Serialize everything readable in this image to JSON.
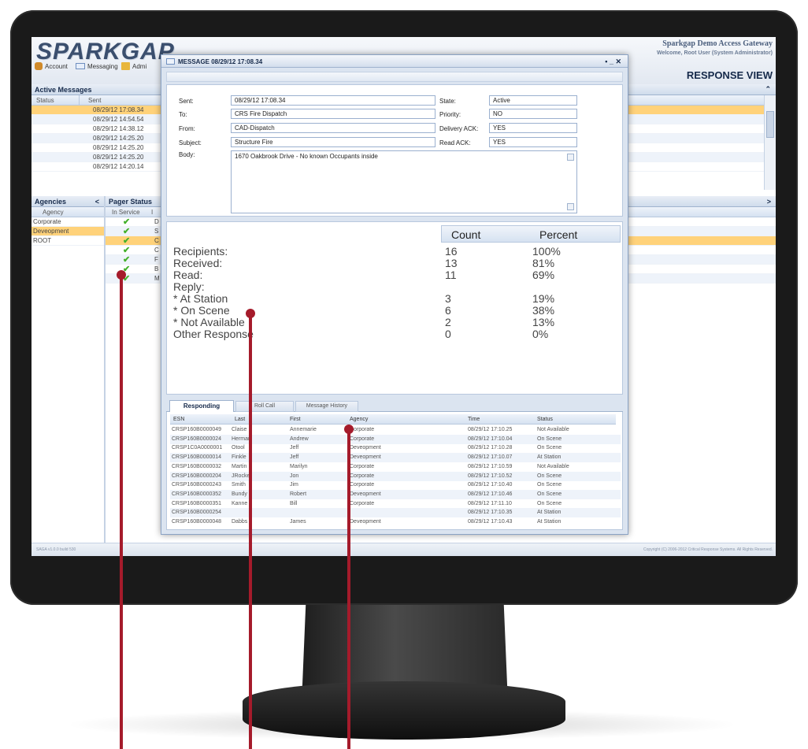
{
  "app": {
    "logo": "SPARKGAP",
    "gateway_title": "Sparkgap Demo Access Gateway",
    "welcome": "Welcome, Root User (System Administrator)",
    "view_title": "RESPONSE VIEW",
    "footer_left": "SAGA v1.0.0 build 530",
    "footer_right": "Copyright (C) 2006-2012 Critical Response Systems. All Rights Reserved."
  },
  "toolbar": {
    "account": "Account",
    "messaging": "Messaging",
    "admin": "Admi"
  },
  "active_messages": {
    "title": "Active Messages",
    "columns": [
      "Status",
      "Sent"
    ],
    "rows": [
      "08/29/12 17:08.34",
      "08/29/12 14:54.54",
      "08/29/12 14:38.12",
      "08/29/12 14:25.20",
      "08/29/12 14:25.20",
      "08/29/12 14:25.20",
      "08/29/12 14:20.14"
    ]
  },
  "agencies": {
    "title": "Agencies",
    "column": "Agency",
    "rows": [
      "Corporate",
      "Deveopment",
      "ROOT"
    ],
    "collapse": "<"
  },
  "pager_status": {
    "title": "Pager Status",
    "columns": [
      "In Service",
      "I"
    ],
    "initials": [
      "D",
      "S",
      "C",
      "C",
      "F",
      "B",
      "M"
    ],
    "expand": ">"
  },
  "dialog": {
    "title": "MESSAGE 08/29/12 17:08.34",
    "controls": "• _ ✕",
    "labels": {
      "sent": "Sent:",
      "to": "To:",
      "from": "From:",
      "subject": "Subject:",
      "body": "Body:",
      "state": "State:",
      "priority": "Priority:",
      "delivery_ack": "Delivery ACK:",
      "read_ack": "Read ACK:"
    },
    "values": {
      "sent": "08/29/12 17:08.34",
      "to": "CRS Fire Dispatch",
      "from": "CAD-Dispatch",
      "subject": "Structure Fire",
      "body": "1670 Oakbrook Drive -  No known Occupants inside",
      "state": "Active",
      "priority": "NO",
      "delivery_ack": "YES",
      "read_ack": "YES"
    },
    "summary": {
      "columns": [
        "Count",
        "Percent"
      ],
      "rows": [
        {
          "label": "Recipients:",
          "count": "16",
          "percent": "100%"
        },
        {
          "label": "Received:",
          "count": "13",
          "percent": "81%"
        },
        {
          "label": "Read:",
          "count": "11",
          "percent": "69%"
        },
        {
          "label": "Reply:",
          "count": "",
          "percent": ""
        },
        {
          "label": "* At Station",
          "count": "3",
          "percent": "19%"
        },
        {
          "label": "* On Scene",
          "count": "6",
          "percent": "38%"
        },
        {
          "label": "* Not Available",
          "count": "2",
          "percent": "13%"
        },
        {
          "label": "Other Response",
          "count": "0",
          "percent": "0%"
        }
      ]
    },
    "tabs": [
      "Responding",
      "Roll Call",
      "Message History"
    ],
    "grid": {
      "columns": [
        "ESN",
        "Last",
        "First",
        "Agency",
        "Time",
        "Status"
      ],
      "rows": [
        [
          "CRSP160B0000049",
          "Claise",
          "Annemarie",
          "Corporate",
          "08/29/12 17:10.25",
          "Not Available"
        ],
        [
          "CRSP160B0000024",
          "Herman",
          "Andrew",
          "Corporate",
          "08/29/12 17:10.04",
          "On Scene"
        ],
        [
          "CRSP1C0A0000001",
          "Otool",
          "Jeff",
          "Deveopment",
          "08/29/12 17:10.28",
          "On Scene"
        ],
        [
          "CRSP160B0000014",
          "Finkle",
          "Jeff",
          "Deveopment",
          "08/29/12 17:10.07",
          "At Station"
        ],
        [
          "CRSP160B0000032",
          "Martin",
          "Marilyn",
          "Corporate",
          "08/29/12 17:10.59",
          "Not Available"
        ],
        [
          "CRSP160B0000204",
          "JRocket",
          "Jon",
          "Corporate",
          "08/29/12 17:10.52",
          "On Scene"
        ],
        [
          "CRSP160B0000243",
          "Smith",
          "Jim",
          "Corporate",
          "08/29/12 17:10.40",
          "On Scene"
        ],
        [
          "CRSP160B0000352",
          "Bundy",
          "Robert",
          "Deveopment",
          "08/29/12 17:10.46",
          "On Scene"
        ],
        [
          "CRSP160B0000351",
          "Kanne",
          "Bill",
          "Corporate",
          "08/29/12 17:11.10",
          "On Scene"
        ],
        [
          "CRSP160B0000254",
          "",
          "",
          "",
          "08/29/12 17:10.35",
          "At Station"
        ],
        [
          "CRSP160B0000048",
          "Dabbs",
          "James",
          "Deveopment",
          "08/29/12 17:10.43",
          "At Station"
        ]
      ]
    }
  },
  "colors": {
    "accent": "#ffd27a",
    "callout": "#a51b2b",
    "check": "#43b02a",
    "header_text": "#15294a"
  }
}
